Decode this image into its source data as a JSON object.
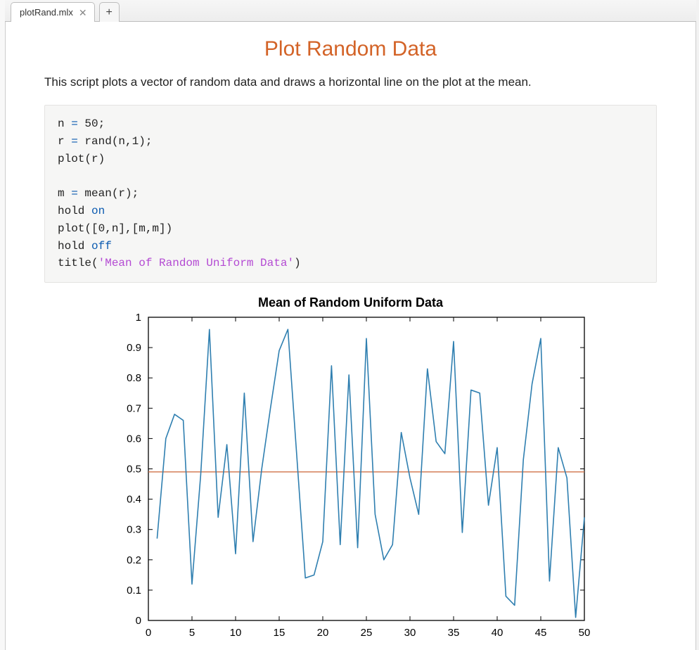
{
  "tabs": {
    "file_name": "plotRand.mlx"
  },
  "page": {
    "title": "Plot Random Data",
    "description": "This script plots a vector of random data and draws a horizontal line on the plot at the mean."
  },
  "code": {
    "l1_a": "n ",
    "l1_b": "=",
    "l1_c": " 50;",
    "l2_a": "r ",
    "l2_b": "=",
    "l2_c": " rand(n,1);",
    "l3": "plot(r)",
    "l4": "",
    "l5_a": "m ",
    "l5_b": "=",
    "l5_c": " mean(r);",
    "l6_a": "hold ",
    "l6_b": "on",
    "l7": "plot([0,n],[m,m])",
    "l8_a": "hold ",
    "l8_b": "off",
    "l9_a": "title(",
    "l9_b": "'Mean of Random Uniform Data'",
    "l9_c": ")"
  },
  "chart_data": {
    "type": "line",
    "title": "Mean of Random Uniform Data",
    "xlabel": "",
    "ylabel": "",
    "xlim": [
      0,
      50
    ],
    "ylim": [
      0,
      1
    ],
    "x_ticks": [
      0,
      5,
      10,
      15,
      20,
      25,
      30,
      35,
      40,
      45,
      50
    ],
    "y_ticks": [
      0,
      0.1,
      0.2,
      0.3,
      0.4,
      0.5,
      0.6,
      0.7,
      0.8,
      0.9,
      1
    ],
    "series": [
      {
        "name": "r",
        "color": "#2f7fb0",
        "x": [
          1,
          2,
          3,
          4,
          5,
          6,
          7,
          8,
          9,
          10,
          11,
          12,
          13,
          14,
          15,
          16,
          17,
          18,
          19,
          20,
          21,
          22,
          23,
          24,
          25,
          26,
          27,
          28,
          29,
          30,
          31,
          32,
          33,
          34,
          35,
          36,
          37,
          38,
          39,
          40,
          41,
          42,
          43,
          44,
          45,
          46,
          47,
          48,
          49,
          50
        ],
        "y": [
          0.27,
          0.6,
          0.68,
          0.66,
          0.12,
          0.48,
          0.96,
          0.34,
          0.58,
          0.22,
          0.75,
          0.26,
          0.5,
          0.7,
          0.89,
          0.96,
          0.55,
          0.14,
          0.15,
          0.26,
          0.84,
          0.25,
          0.81,
          0.24,
          0.93,
          0.35,
          0.2,
          0.25,
          0.62,
          0.47,
          0.35,
          0.83,
          0.59,
          0.55,
          0.92,
          0.29,
          0.76,
          0.75,
          0.38,
          0.57,
          0.08,
          0.05,
          0.53,
          0.78,
          0.93,
          0.13,
          0.57,
          0.47,
          0.01,
          0.34
        ]
      }
    ],
    "mean_line": {
      "value": 0.49,
      "color": "#d1734a",
      "x0": 0,
      "x1": 50
    }
  }
}
